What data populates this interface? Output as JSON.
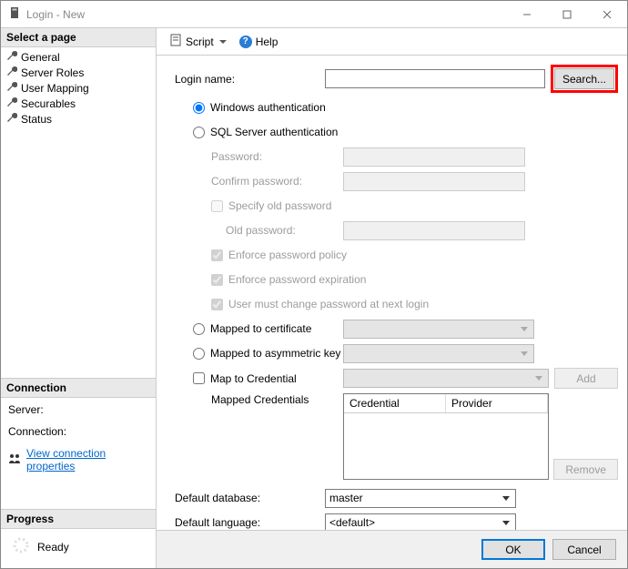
{
  "window": {
    "title": "Login - New"
  },
  "sidebar": {
    "select_page": "Select a page",
    "pages": [
      "General",
      "Server Roles",
      "User Mapping",
      "Securables",
      "Status"
    ],
    "connection_head": "Connection",
    "server_label": "Server:",
    "connection_label": "Connection:",
    "view_props": "View connection properties",
    "progress_head": "Progress",
    "progress_status": "Ready"
  },
  "toolbar": {
    "script": "Script",
    "help": "Help"
  },
  "form": {
    "login_name": "Login name:",
    "search": "Search...",
    "win_auth": "Windows authentication",
    "sql_auth": "SQL Server authentication",
    "password": "Password:",
    "confirm_password": "Confirm password:",
    "specify_old": "Specify old password",
    "old_password": "Old password:",
    "enforce_policy": "Enforce password policy",
    "enforce_expiration": "Enforce password expiration",
    "must_change": "User must change password at next login",
    "mapped_cert": "Mapped to certificate",
    "mapped_asym": "Mapped to asymmetric key",
    "map_cred": "Map to Credential",
    "add": "Add",
    "mapped_creds": "Mapped Credentials",
    "col_credential": "Credential",
    "col_provider": "Provider",
    "remove": "Remove",
    "default_db": "Default database:",
    "default_db_value": "master",
    "default_lang": "Default language:",
    "default_lang_value": "<default>"
  },
  "footer": {
    "ok": "OK",
    "cancel": "Cancel"
  }
}
